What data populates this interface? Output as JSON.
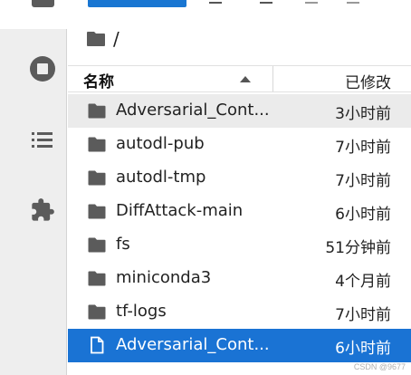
{
  "sidebar": {
    "items": [
      {
        "icon": "folder-tab-icon"
      },
      {
        "icon": "running-stop-icon"
      },
      {
        "icon": "table-of-contents-icon"
      },
      {
        "icon": "extension-puzzle-icon"
      }
    ]
  },
  "breadcrumb": {
    "path": "/"
  },
  "header": {
    "name_label": "名称",
    "modified_label": "已修改"
  },
  "files": [
    {
      "name": "Adversarial_Cont...",
      "modified": "3小时前",
      "type": "folder",
      "state": "hover"
    },
    {
      "name": "autodl-pub",
      "modified": "7小时前",
      "type": "folder",
      "state": "normal"
    },
    {
      "name": "autodl-tmp",
      "modified": "7小时前",
      "type": "folder",
      "state": "normal"
    },
    {
      "name": "DiffAttack-main",
      "modified": "6小时前",
      "type": "folder",
      "state": "normal"
    },
    {
      "name": "fs",
      "modified": "51分钟前",
      "type": "folder",
      "state": "normal"
    },
    {
      "name": "miniconda3",
      "modified": "4个月前",
      "type": "folder",
      "state": "normal"
    },
    {
      "name": "tf-logs",
      "modified": "7小时前",
      "type": "folder",
      "state": "normal"
    },
    {
      "name": "Adversarial_Cont...",
      "modified": "6小时前",
      "type": "file",
      "state": "selected"
    }
  ],
  "watermark": "CSDN @9677",
  "colors": {
    "accent": "#1a73d4",
    "hover": "#ebebeb",
    "sidebar_bg": "#eeeeee",
    "icon": "#5b5b5b"
  }
}
